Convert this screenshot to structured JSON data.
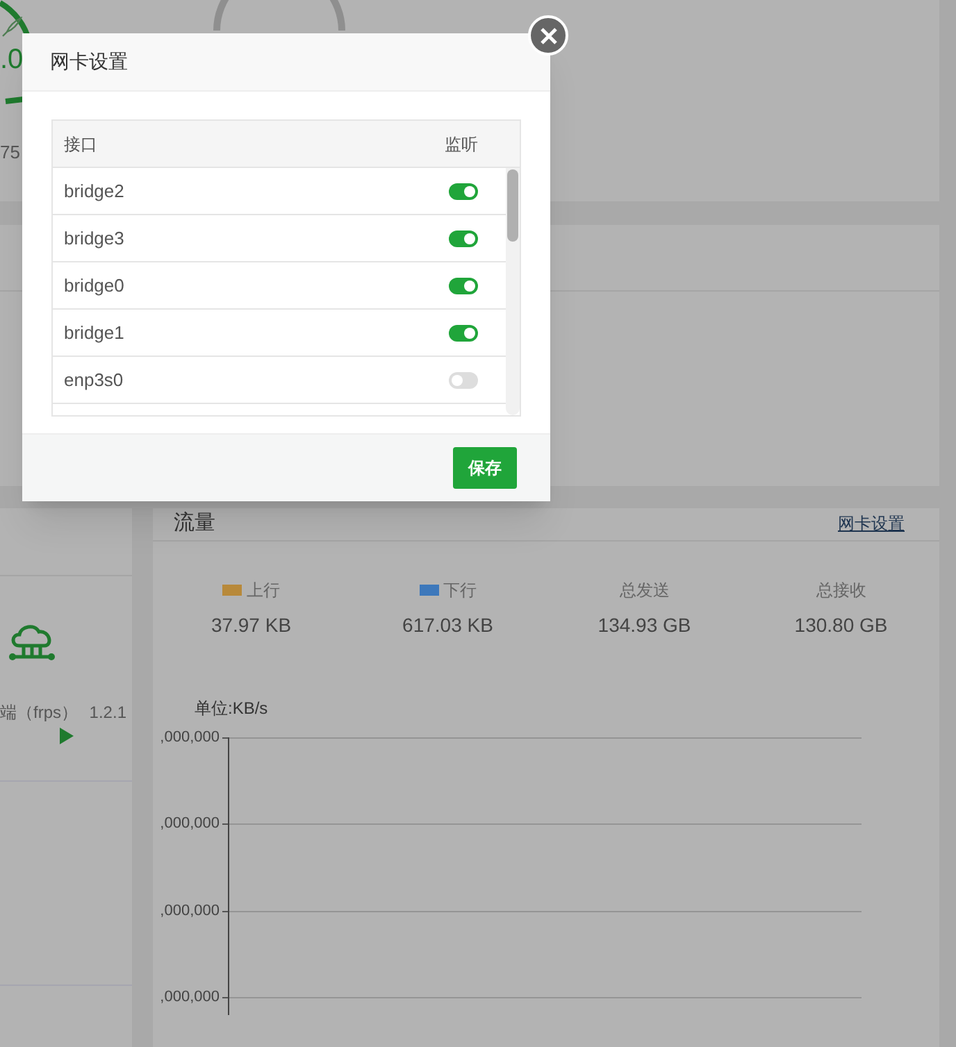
{
  "gauges": [
    {
      "value": ".0",
      "subvalue": "75"
    }
  ],
  "left_panel": {
    "app_name": "端（frps）",
    "version": "1.2.1"
  },
  "traffic": {
    "title": "流量",
    "settings_link": "网卡设置",
    "stats": [
      {
        "label": "上行",
        "value": "37.97 KB",
        "color": "#b8893a"
      },
      {
        "label": "下行",
        "value": "617.03 KB",
        "color": "#3d78bb"
      },
      {
        "label": "总发送",
        "value": "134.93 GB"
      },
      {
        "label": "总接收",
        "value": "130.80 GB"
      }
    ],
    "chart": {
      "unit": "单位:KB/s",
      "y_tick_labels": [
        ",000,000",
        ",000,000",
        ",000,000",
        ",000,000"
      ]
    }
  },
  "dialog": {
    "title": "网卡设置",
    "columns": [
      "接口",
      "监听"
    ],
    "rows": [
      {
        "name": "bridge2",
        "on": true
      },
      {
        "name": "bridge3",
        "on": true
      },
      {
        "name": "bridge0",
        "on": true
      },
      {
        "name": "bridge1",
        "on": true
      },
      {
        "name": "enp3s0",
        "on": false
      }
    ],
    "save_button": "保存"
  }
}
